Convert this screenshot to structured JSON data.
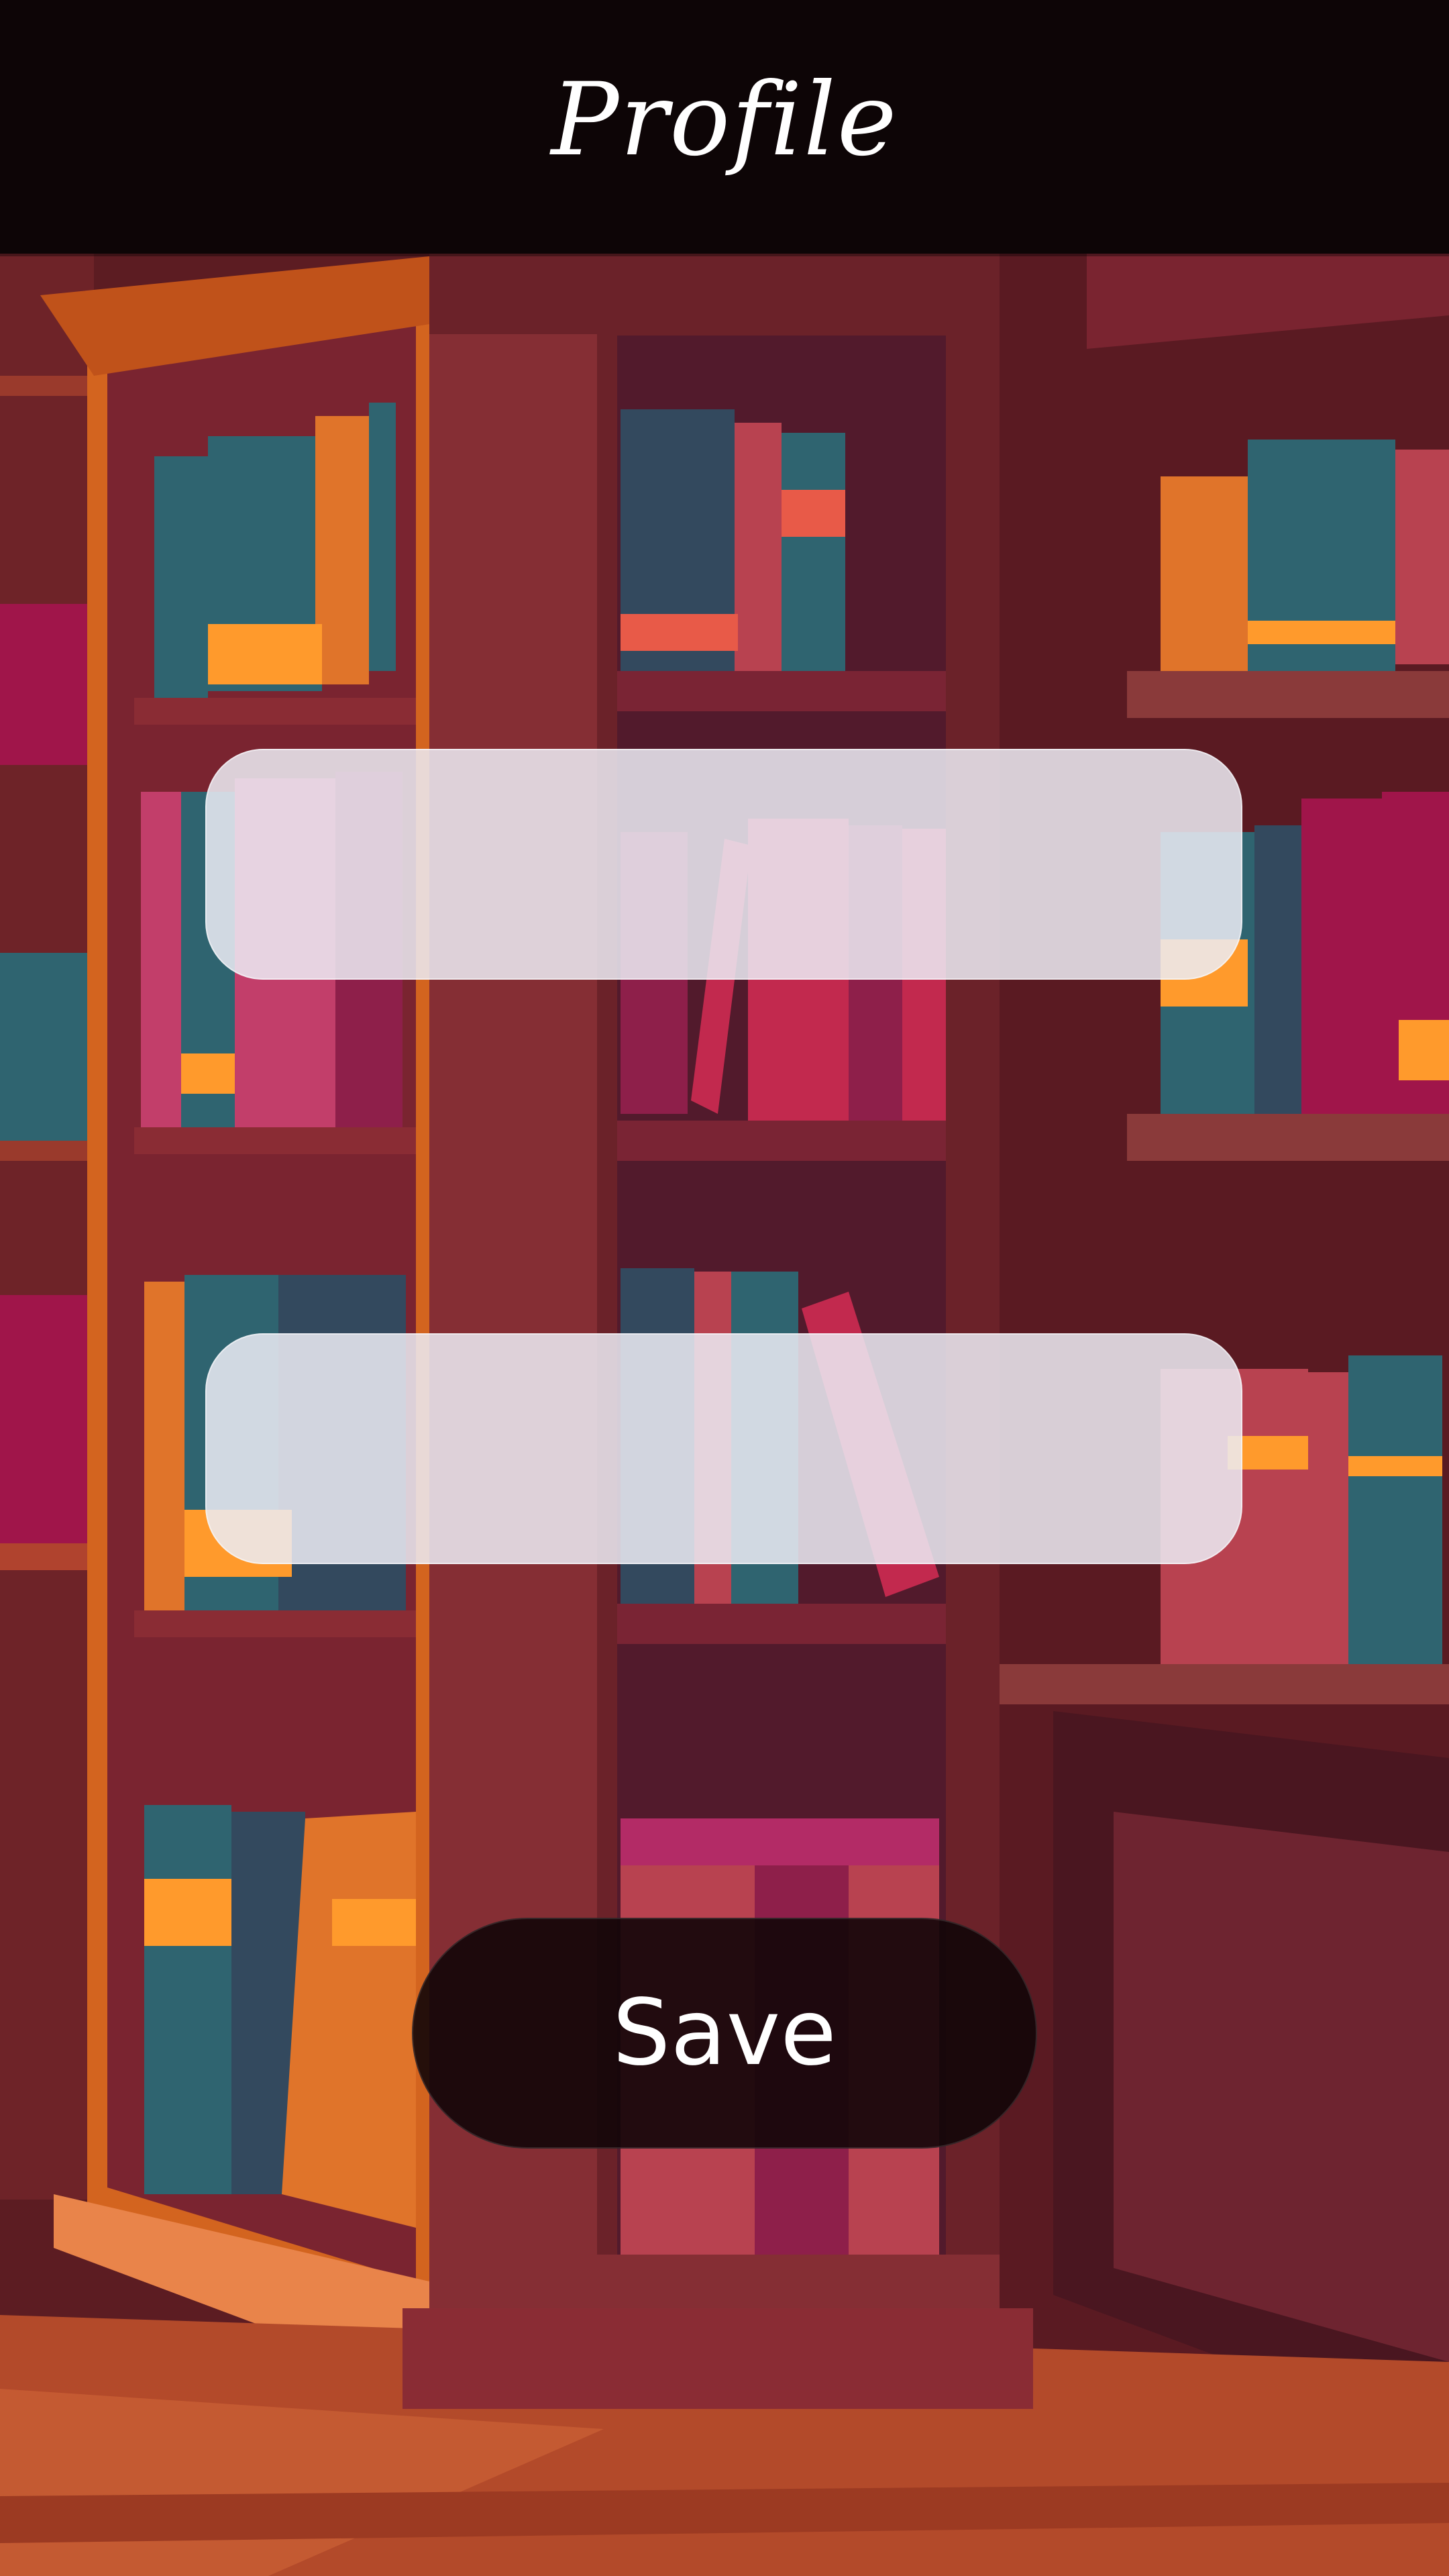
{
  "header": {
    "title": "Profile"
  },
  "form": {
    "field_1": {
      "value": "",
      "placeholder": ""
    },
    "field_2": {
      "value": "",
      "placeholder": ""
    },
    "save_label": "Save"
  },
  "colors": {
    "header_background": "#0d0506",
    "button_background": "#120608",
    "field_background": "#ececf4",
    "text_light": "#ffffff"
  }
}
